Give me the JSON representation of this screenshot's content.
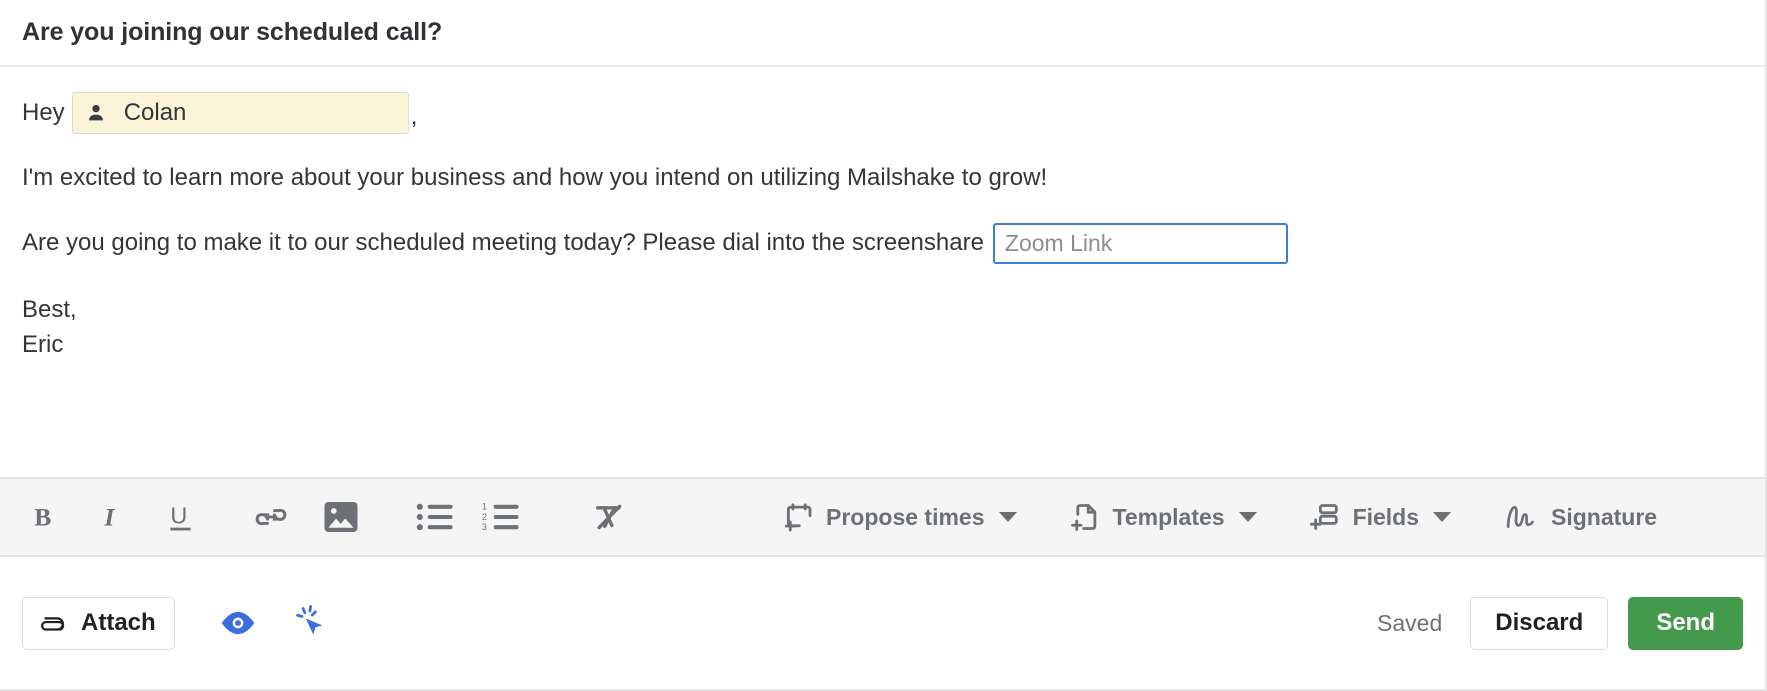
{
  "subject": {
    "text": "Are you joining our scheduled call?"
  },
  "body": {
    "greeting_word": "Hey",
    "merge_field": {
      "icon": "person-icon",
      "label": "Colan"
    },
    "greeting_comma": ",",
    "paragraph_1": "I'm excited to learn more about your business and how you intend on utilizing Mailshake to grow!",
    "meeting_text": "Are you going to make it to our scheduled meeting today? Please dial into the screenshare",
    "zoom_link": {
      "value": "",
      "placeholder": "Zoom Link"
    },
    "signoff": "Best,",
    "sender_name": "Eric"
  },
  "format_toolbar": {
    "items": [
      {
        "name": "bold-icon",
        "label": "B"
      },
      {
        "name": "italic-icon",
        "label": "I"
      },
      {
        "name": "underline-icon",
        "label": "U"
      },
      {
        "name": "link-icon",
        "label": "Link"
      },
      {
        "name": "image-icon",
        "label": "Image"
      },
      {
        "name": "bulleted-list-icon",
        "label": "Bulleted list"
      },
      {
        "name": "numbered-list-icon",
        "label": "Numbered list"
      },
      {
        "name": "clear-formatting-icon",
        "label": "Clear formatting"
      }
    ],
    "menus": [
      {
        "name": "propose-times",
        "label": "Propose times",
        "icon": "calendar-plus-icon",
        "caret": true
      },
      {
        "name": "templates",
        "label": "Templates",
        "icon": "file-plus-icon",
        "caret": true
      },
      {
        "name": "fields",
        "label": "Fields",
        "icon": "fields-plus-icon",
        "caret": true
      },
      {
        "name": "signature",
        "label": "Signature",
        "icon": "signature-squiggle-icon",
        "caret": false
      }
    ]
  },
  "action_bar": {
    "attach_label": "Attach",
    "attach_icon": "paperclip-icon",
    "preview_icon": "eye-icon",
    "click_tracking_icon": "cursor-click-icon",
    "status_label": "Saved",
    "discard_label": "Discard",
    "send_label": "Send"
  },
  "colors": {
    "accent_blue": "#3b7dd8",
    "send_green": "#439a4d",
    "merge_chip_bg": "#fbf4d8",
    "toolbar_bg": "#f5f5f6",
    "icon_gray": "#6d7175"
  }
}
